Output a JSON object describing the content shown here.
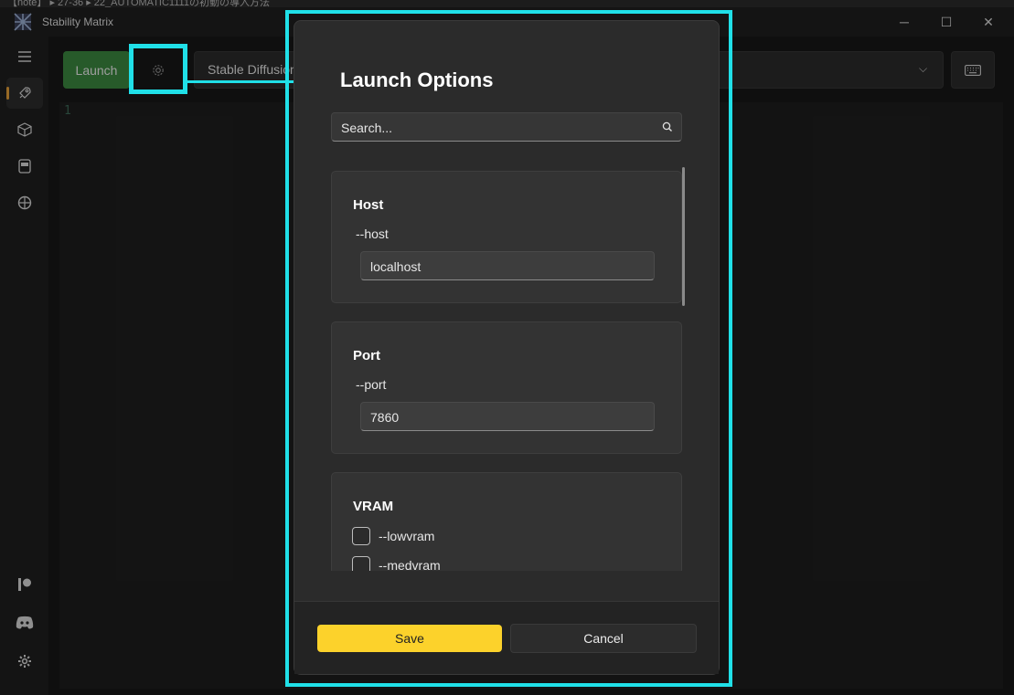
{
  "background_window": {
    "title_fragment": "【note】 ▸ 27-36 ▸ 22_AUTOMATIC1111の初動の導入方法"
  },
  "app": {
    "title": "Stability Matrix"
  },
  "window_controls": {
    "minimize": "─",
    "maximize": "☐",
    "close": "✕"
  },
  "sidebar": {
    "items": [
      {
        "icon": "menu-icon"
      },
      {
        "icon": "rocket-icon",
        "active": true
      },
      {
        "icon": "package-icon"
      },
      {
        "icon": "storage-icon"
      },
      {
        "icon": "model-browser-icon"
      }
    ],
    "footer_items": [
      {
        "icon": "patreon-icon"
      },
      {
        "icon": "discord-icon"
      },
      {
        "icon": "settings-gear-icon"
      }
    ]
  },
  "toolbar": {
    "launch_label": "Launch",
    "package_selected": "Stable Diffusion",
    "chevron": "⌵"
  },
  "console": {
    "line_number": "1"
  },
  "dialog": {
    "title": "Launch Options",
    "search_placeholder": "Search...",
    "options": [
      {
        "title": "Host",
        "flag": "--host",
        "value": "localhost"
      },
      {
        "title": "Port",
        "flag": "--port",
        "value": "7860"
      }
    ],
    "vram": {
      "title": "VRAM",
      "checkboxes": [
        "--lowvram",
        "--medvram"
      ]
    },
    "save_label": "Save",
    "cancel_label": "Cancel"
  },
  "colors": {
    "accent_launch": "#3d8b41",
    "save_yellow": "#fcd22b",
    "highlight_cyan": "#20e0e8",
    "nav_indicator": "#e8a23a"
  }
}
